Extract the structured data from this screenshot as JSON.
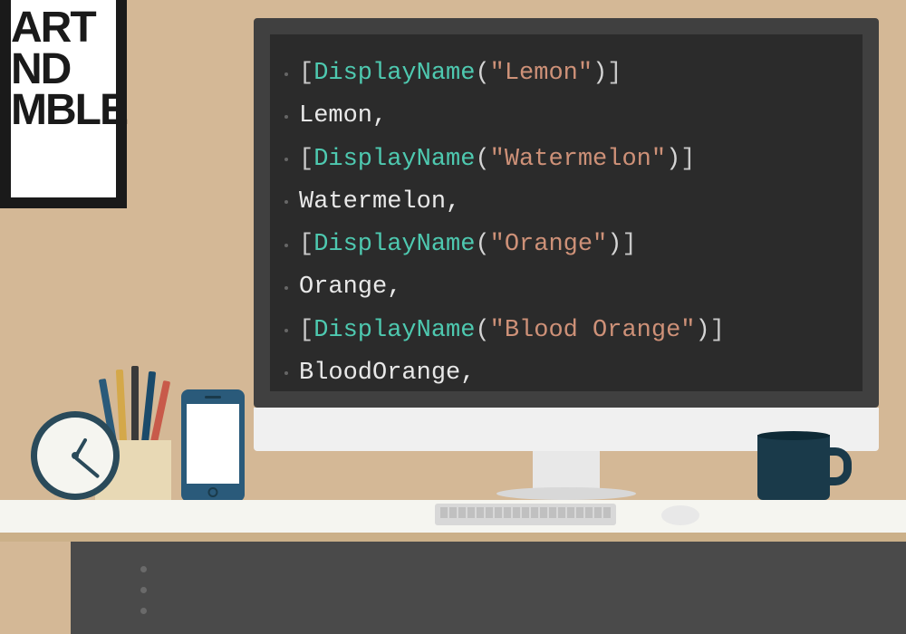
{
  "poster": {
    "line1": "ART",
    "line2": "ND",
    "line3": "MBLE"
  },
  "code": {
    "lines": [
      {
        "type": "attr",
        "name": "DisplayName",
        "arg": "\"Lemon\""
      },
      {
        "type": "ident",
        "value": "Lemon,"
      },
      {
        "type": "attr",
        "name": "DisplayName",
        "arg": "\"Watermelon\""
      },
      {
        "type": "ident",
        "value": "Watermelon,"
      },
      {
        "type": "attr",
        "name": "DisplayName",
        "arg": "\"Orange\""
      },
      {
        "type": "ident",
        "value": "Orange,"
      },
      {
        "type": "attr",
        "name": "DisplayName",
        "arg": "\"Blood Orange\""
      },
      {
        "type": "ident",
        "value": "BloodOrange,"
      }
    ]
  },
  "colors": {
    "wall": "#d4b896",
    "screen_bg": "#2b2b2b",
    "attr_color": "#4ec9b0",
    "string_color": "#ce9178",
    "desk_front": "#4a4a4a",
    "mug": "#1a3a4a"
  }
}
